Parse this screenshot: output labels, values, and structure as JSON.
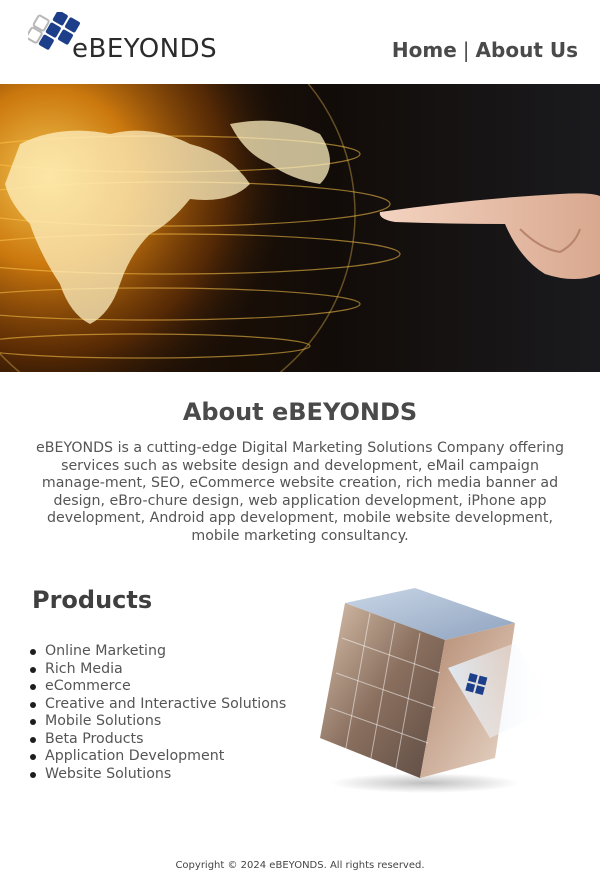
{
  "header": {
    "logo_text": "eBEYONDS",
    "nav": [
      {
        "label": "Home"
      },
      {
        "label": "About Us"
      }
    ],
    "nav_separator": "|"
  },
  "hero": {
    "image": "globe-and-finger-image"
  },
  "about": {
    "title": "About eBEYONDS",
    "body": "eBEYONDS is a cutting-edge Digital Marketing Solutions Company offering services such as website design and development, eMail campaign manage-ment, SEO, eCommerce website creation, rich media banner ad design, eBro-chure design, web application development, iPhone app development, Android app development, mobile website development, mobile marketing consultancy."
  },
  "products": {
    "title": "Products",
    "items": [
      {
        "label": "Online Marketing"
      },
      {
        "label": "Rich Media"
      },
      {
        "label": "eCommerce"
      },
      {
        "label": "Creative and Interactive Solutions"
      },
      {
        "label": "Mobile Solutions"
      },
      {
        "label": "Beta Products"
      },
      {
        "label": "Application Development"
      },
      {
        "label": "Website Solutions"
      }
    ],
    "image": "photo-cube-image"
  },
  "footer": {
    "copyright": "Copyright © 2024 eBEYONDS. All rights reserved."
  },
  "colors": {
    "brand_blue": "#1d3f8a",
    "text": "#4a4a4a",
    "hero_gold": "#f2a31a"
  }
}
